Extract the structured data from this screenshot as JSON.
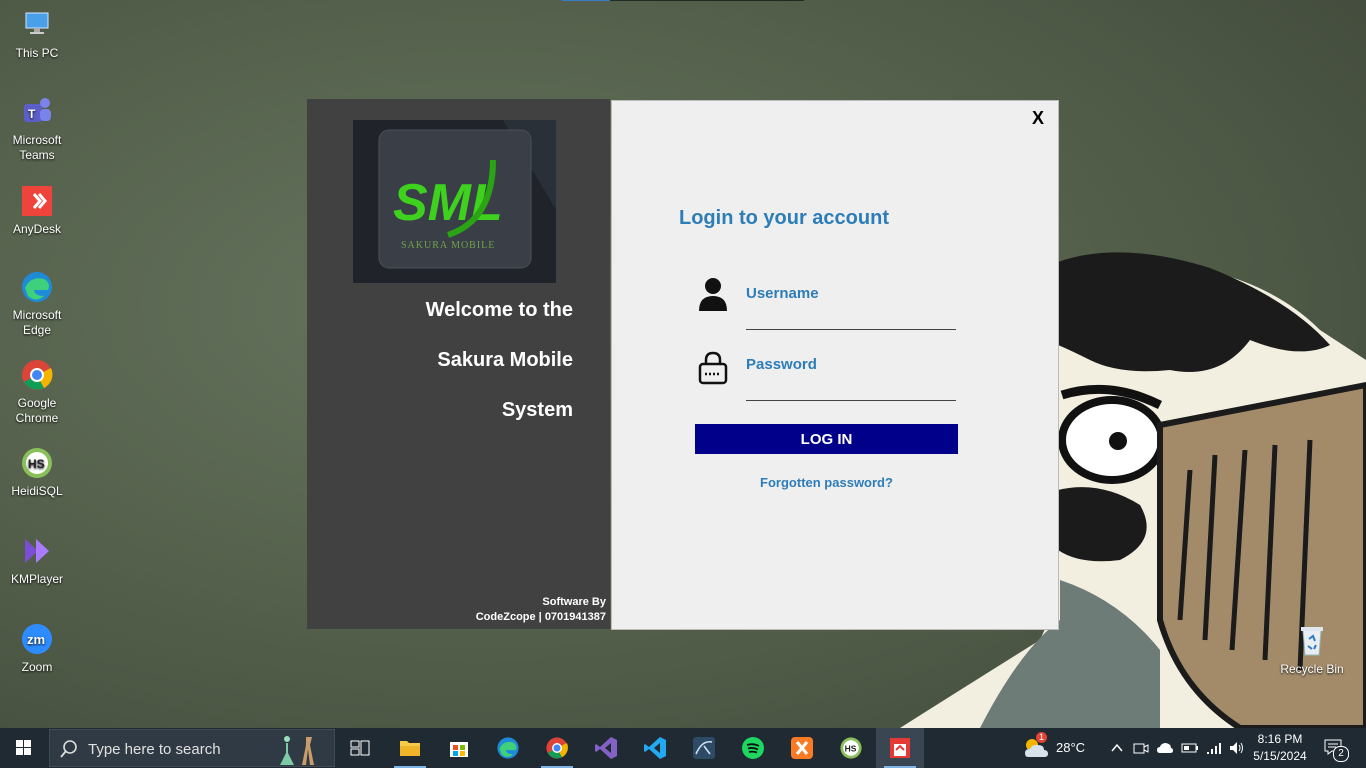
{
  "desktop": {
    "icons": [
      {
        "label": "This PC"
      },
      {
        "label": "Microsoft Teams"
      },
      {
        "label": "AnyDesk"
      },
      {
        "label": "Microsoft Edge"
      },
      {
        "label": "Google Chrome"
      },
      {
        "label": "HeidiSQL"
      },
      {
        "label": "KMPlayer"
      },
      {
        "label": "Zoom"
      }
    ],
    "recycle_bin": "Recycle Bin"
  },
  "window": {
    "logo_text": "SML",
    "logo_subtext": "SAKURA MOBILE",
    "welcome_lines": [
      "Welcome to the",
      "Sakura Mobile",
      "System"
    ],
    "credit_line1": "Software By",
    "credit_line2": "CodeZcope | 0701941387",
    "close_label": "X",
    "heading": "Login to your account",
    "username_label": "Username",
    "username_value": "",
    "password_label": "Password",
    "password_value": "",
    "login_button": "LOG IN",
    "forgot_link": "Forgotten password?"
  },
  "taskbar": {
    "search_placeholder": "Type here to search",
    "weather_temp": "28°C",
    "weather_badge": "1",
    "time": "8:16 PM",
    "date": "5/15/2024",
    "notification_count": "2",
    "apps": [
      "task-view",
      "file-explorer",
      "microsoft-store",
      "edge",
      "chrome",
      "visual-studio",
      "vscode",
      "mysql-workbench",
      "spotify",
      "xampp",
      "heidisql",
      "sakura-app"
    ]
  },
  "colors": {
    "accent_blue": "#2d7db8",
    "login_button_bg": "#00008b",
    "left_panel_bg": "#414141",
    "right_panel_bg": "#efefef",
    "taskbar_bg": "#1f2a33"
  }
}
